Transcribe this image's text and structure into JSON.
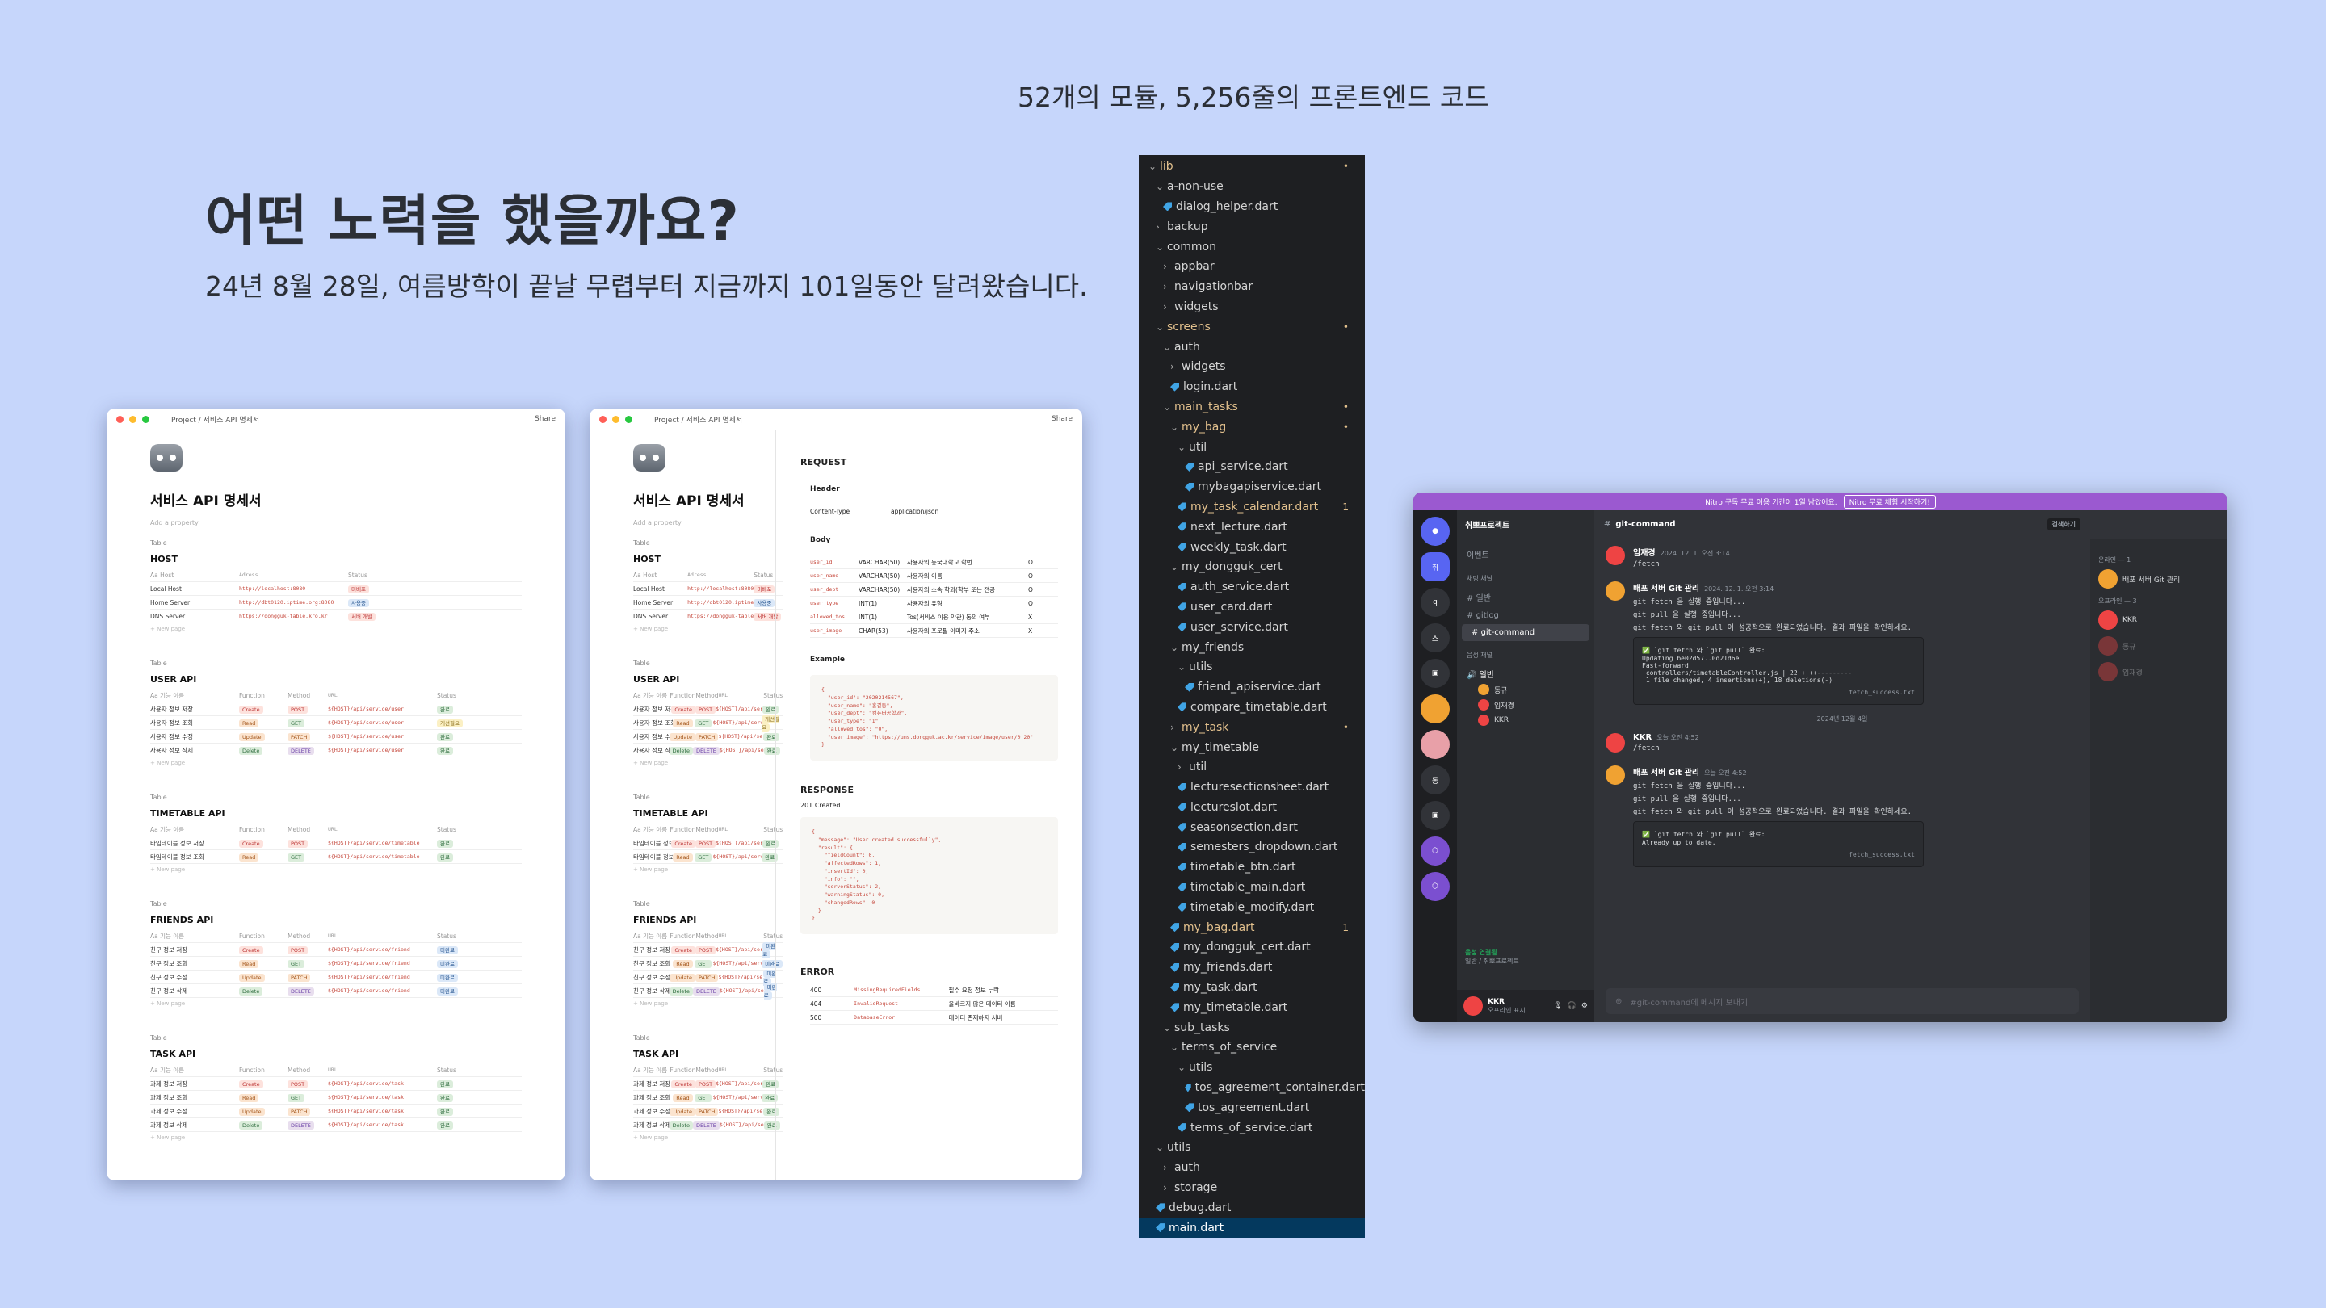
{
  "caption": "52개의 모듈, 5,256줄의 프론트엔드 코드",
  "headline": "어떤 노력을 했을까요?",
  "subline": "24년 8월 28일, 여름방학이 끝날 무렵부터 지금까지 101일동안 달려왔습니다.",
  "notion": {
    "breadcrumb": "Project / 서비스 API 명세서",
    "share": "Share",
    "title": "서비스 API 명세서",
    "add_property": "Add a property",
    "table_label": "Table",
    "new_page": "+ New page",
    "host_title": "HOST",
    "host_head": [
      "Aa Host",
      "Adress",
      "Status"
    ],
    "host_rows": [
      [
        "Local Host",
        "http://localhost:8080",
        "미배포"
      ],
      [
        "Home Server",
        "http://dbt0120.iptime.org:8080",
        "사용중"
      ],
      [
        "DNS Server",
        "https://dongguk-table.kro.kr",
        "서버 개발"
      ]
    ],
    "api_head": [
      "Aa 기능 이름",
      "Function",
      "Method",
      "URL",
      "Status"
    ],
    "user_title": "USER API",
    "user_rows": [
      [
        "사용자 정보 저장",
        "Create",
        "POST",
        "${HOST}/api/service/user",
        "완료"
      ],
      [
        "사용자 정보 조회",
        "Read",
        "GET",
        "${HOST}/api/service/user",
        "개선필요"
      ],
      [
        "사용자 정보 수정",
        "Update",
        "PATCH",
        "${HOST}/api/service/user",
        "완료"
      ],
      [
        "사용자 정보 삭제",
        "Delete",
        "DELETE",
        "${HOST}/api/service/user",
        "완료"
      ]
    ],
    "timetable_title": "TIMETABLE API",
    "timetable_rows": [
      [
        "타임테이블 정보 저장",
        "Create",
        "POST",
        "${HOST}/api/service/timetable",
        "완료"
      ],
      [
        "타임테이블 정보 조회",
        "Read",
        "GET",
        "${HOST}/api/service/timetable",
        "완료"
      ]
    ],
    "friends_title": "FRIENDS API",
    "friends_rows": [
      [
        "친구 정보 저장",
        "Create",
        "POST",
        "${HOST}/api/service/friend",
        "미완료"
      ],
      [
        "친구 정보 조회",
        "Read",
        "GET",
        "${HOST}/api/service/friend",
        "미완료"
      ],
      [
        "친구 정보 수정",
        "Update",
        "PATCH",
        "${HOST}/api/service/friend",
        "미완료"
      ],
      [
        "친구 정보 삭제",
        "Delete",
        "DELETE",
        "${HOST}/api/service/friend",
        "미완료"
      ]
    ],
    "task_title": "TASK API",
    "task_rows": [
      [
        "과제 정보 저장",
        "Create",
        "POST",
        "${HOST}/api/service/task",
        "완료"
      ],
      [
        "과제 정보 조회",
        "Read",
        "GET",
        "${HOST}/api/service/task",
        "완료"
      ],
      [
        "과제 정보 수정",
        "Update",
        "PATCH",
        "${HOST}/api/service/task",
        "완료"
      ],
      [
        "과제 정보 삭제",
        "Delete",
        "DELETE",
        "${HOST}/api/service/task",
        "완료"
      ]
    ],
    "request": "REQUEST",
    "header": "Header",
    "header_row": [
      "Content-Type",
      "application/json"
    ],
    "body": "Body",
    "body_rows": [
      [
        "user_id",
        "VARCHAR(50)",
        "사용자의 동국대학교 학번",
        "O"
      ],
      [
        "user_name",
        "VARCHAR(50)",
        "사용자의 이름",
        "O"
      ],
      [
        "user_dept",
        "VARCHAR(50)",
        "사용자의 소속 학과(학부 또는 전공",
        "O"
      ],
      [
        "user_type",
        "INT(1)",
        "사용자의 유형",
        "O"
      ],
      [
        "allowed_tos",
        "INT(1)",
        "Tos(서비스 이용 약관) 동의 여부",
        "X"
      ],
      [
        "user_image",
        "CHAR(53)",
        "사용자의 프로필 이미지 주소",
        "X"
      ]
    ],
    "example": "Example",
    "example_code": "{\n  \"user_id\": \"2020214567\",\n  \"user_name\": \"홍길동\",\n  \"user_dept\": \"컴퓨터공학과\",\n  \"user_type\": \"1\",\n  \"allowed_tos\": \"0\",\n  \"user_image\": \"https://ums.dongguk.ac.kr/service/image/user/0_20\"\n}",
    "response": "RESPONSE",
    "response_status": "201 Created",
    "response_code": "{\n  \"message\": \"User created successfully\",\n  \"result\": {\n    \"fieldCount\": 0,\n    \"affectedRows\": 1,\n    \"insertId\": 0,\n    \"info\": \"\",\n    \"serverStatus\": 2,\n    \"warningStatus\": 0,\n    \"changedRows\": 0\n  }\n}",
    "error": "ERROR",
    "error_rows": [
      [
        "400",
        "MissingRequiredFields",
        "필수 요청 정보 누락"
      ],
      [
        "404",
        "InvalidRequest",
        "올바르지 않은 데이터 이름"
      ],
      [
        "500",
        "DatabaseError",
        "데이터 존재하지 서버"
      ]
    ]
  },
  "explorer": [
    {
      "d": 0,
      "t": "lib",
      "f": 1,
      "m": "•",
      "c": "mod"
    },
    {
      "d": 1,
      "t": "a-non-use",
      "f": 1
    },
    {
      "d": 2,
      "t": "dialog_helper.dart",
      "f": 0
    },
    {
      "d": 1,
      "t": "backup",
      "f": 2
    },
    {
      "d": 1,
      "t": "common",
      "f": 1
    },
    {
      "d": 2,
      "t": "appbar",
      "f": 2
    },
    {
      "d": 2,
      "t": "navigationbar",
      "f": 2
    },
    {
      "d": 2,
      "t": "widgets",
      "f": 2
    },
    {
      "d": 1,
      "t": "screens",
      "f": 1,
      "m": "•",
      "c": "mod"
    },
    {
      "d": 2,
      "t": "auth",
      "f": 1
    },
    {
      "d": 3,
      "t": "widgets",
      "f": 2
    },
    {
      "d": 3,
      "t": "login.dart",
      "f": 0
    },
    {
      "d": 2,
      "t": "main_tasks",
      "f": 1,
      "m": "•",
      "c": "mod"
    },
    {
      "d": 3,
      "t": "my_bag",
      "f": 1,
      "m": "•",
      "c": "mod"
    },
    {
      "d": 4,
      "t": "util",
      "f": 1
    },
    {
      "d": 5,
      "t": "api_service.dart",
      "f": 0
    },
    {
      "d": 5,
      "t": "mybagapiservice.dart",
      "f": 0
    },
    {
      "d": 4,
      "t": "my_task_calendar.dart",
      "f": 0,
      "m": "1",
      "c": "mod"
    },
    {
      "d": 4,
      "t": "next_lecture.dart",
      "f": 0
    },
    {
      "d": 4,
      "t": "weekly_task.dart",
      "f": 0
    },
    {
      "d": 3,
      "t": "my_dongguk_cert",
      "f": 1
    },
    {
      "d": 4,
      "t": "auth_service.dart",
      "f": 0
    },
    {
      "d": 4,
      "t": "user_card.dart",
      "f": 0
    },
    {
      "d": 4,
      "t": "user_service.dart",
      "f": 0
    },
    {
      "d": 3,
      "t": "my_friends",
      "f": 1
    },
    {
      "d": 4,
      "t": "utils",
      "f": 1
    },
    {
      "d": 5,
      "t": "friend_apiservice.dart",
      "f": 0
    },
    {
      "d": 4,
      "t": "compare_timetable.dart",
      "f": 0
    },
    {
      "d": 3,
      "t": "my_task",
      "f": 2,
      "m": "•",
      "c": "mod"
    },
    {
      "d": 3,
      "t": "my_timetable",
      "f": 1
    },
    {
      "d": 4,
      "t": "util",
      "f": 2
    },
    {
      "d": 4,
      "t": "lecturesectionsheet.dart",
      "f": 0
    },
    {
      "d": 4,
      "t": "lectureslot.dart",
      "f": 0
    },
    {
      "d": 4,
      "t": "seasonsection.dart",
      "f": 0
    },
    {
      "d": 4,
      "t": "semesters_dropdown.dart",
      "f": 0
    },
    {
      "d": 4,
      "t": "timetable_btn.dart",
      "f": 0
    },
    {
      "d": 4,
      "t": "timetable_main.dart",
      "f": 0
    },
    {
      "d": 4,
      "t": "timetable_modify.dart",
      "f": 0
    },
    {
      "d": 3,
      "t": "my_bag.dart",
      "f": 0,
      "m": "1",
      "c": "mod"
    },
    {
      "d": 3,
      "t": "my_dongguk_cert.dart",
      "f": 0
    },
    {
      "d": 3,
      "t": "my_friends.dart",
      "f": 0
    },
    {
      "d": 3,
      "t": "my_task.dart",
      "f": 0
    },
    {
      "d": 3,
      "t": "my_timetable.dart",
      "f": 0
    },
    {
      "d": 2,
      "t": "sub_tasks",
      "f": 1
    },
    {
      "d": 3,
      "t": "terms_of_service",
      "f": 1
    },
    {
      "d": 4,
      "t": "utils",
      "f": 1
    },
    {
      "d": 5,
      "t": "tos_agreement_container.dart",
      "f": 0
    },
    {
      "d": 5,
      "t": "tos_agreement.dart",
      "f": 0
    },
    {
      "d": 4,
      "t": "terms_of_service.dart",
      "f": 0
    },
    {
      "d": 1,
      "t": "utils",
      "f": 1
    },
    {
      "d": 2,
      "t": "auth",
      "f": 2
    },
    {
      "d": 2,
      "t": "storage",
      "f": 2
    },
    {
      "d": 1,
      "t": "debug.dart",
      "f": 0
    },
    {
      "d": 1,
      "t": "main.dart",
      "f": 0,
      "c": "sel"
    }
  ],
  "discord": {
    "nitro_text": "Nitro 구독 무료 이용 기간이 1일 남았어요.",
    "nitro_button": "Nitro 무료 체험 시작하기!",
    "server_name": "취뽀프로젝트",
    "events": "이벤트",
    "text_category": "채팅 채널",
    "channels": [
      "일반",
      "gitlog",
      "git-command"
    ],
    "voice_category": "음성 채널",
    "voice_channel": "일반",
    "voice_users": [
      "동규",
      "임재경",
      "KKR"
    ],
    "voice_status": "음성 연결됨",
    "voice_status_sub": "일반 / 취뽀프로젝트",
    "me_name": "KKR",
    "me_status": "오프라인 표시",
    "channel_title": "git-command",
    "search": "검색하기",
    "messages": [
      {
        "who": "임재경",
        "time": "2024. 12. 1. 오전 3:14",
        "lines": [
          "/fetch"
        ]
      },
      {
        "who": "배포 서버 Git 관리",
        "time": "2024. 12. 1. 오전 3:14",
        "lines": [
          "git fetch 을 실행 중입니다...",
          "git pull 을 실행 중입니다...",
          "git fetch 와 git pull 이 성공적으로 완료되었습니다. 결과 파일을 확인하세요."
        ],
        "file": "✅ `git fetch`와 `git pull` 완료:\nUpdating be02d57..0d21d6e\nFast-forward\n controllers/timetableController.js | 22 ++++---------\n 1 file changed, 4 insertions(+), 18 deletions(-)",
        "file_name": "fetch_success.txt"
      },
      {
        "who": "KKR",
        "time": "오늘 오전 4:52",
        "lines": [
          "/fetch"
        ]
      },
      {
        "who": "배포 서버 Git 관리",
        "time": "오늘 오전 4:52",
        "lines": [
          "git fetch 을 실행 중입니다...",
          "git pull 을 실행 중입니다...",
          "git fetch 와 git pull 이 성공적으로 완료되었습니다. 결과 파일을 확인하세요."
        ],
        "file": "✅ `git fetch`와 `git pull` 완료:\nAlready up to date.",
        "file_name": "fetch_success.txt"
      }
    ],
    "date_divider": "2024년 12월 4일",
    "input_placeholder": "#git-command에 메시지 보내기",
    "members_online": "온라인 — 1",
    "member_bot": "배포 서버 Git 관리",
    "members_offline": "오프라인 — 3",
    "offline_members": [
      "KKR",
      "동규",
      "임재경"
    ]
  }
}
